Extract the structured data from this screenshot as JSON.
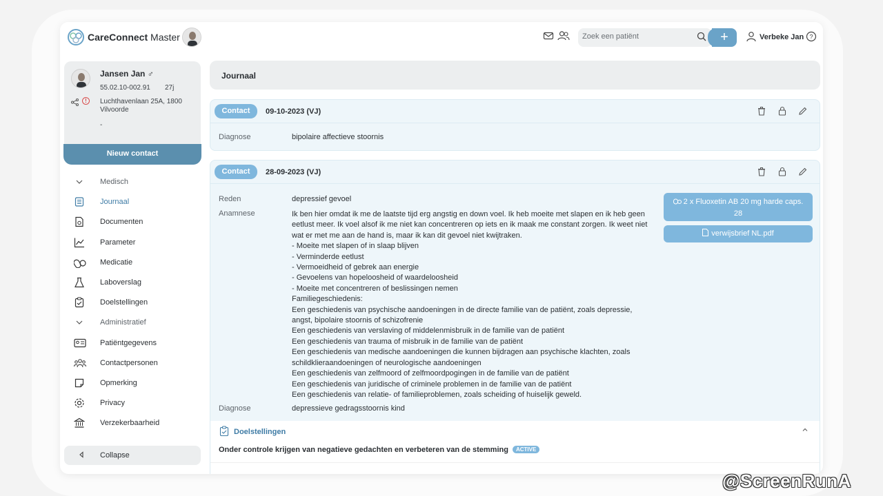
{
  "app": {
    "title_bold": "CareConnect",
    "title_light": "Master",
    "colors": {
      "accent": "#7fb7dd",
      "accent_dark": "#5b8fae",
      "link": "#3e7ba5"
    }
  },
  "topbar": {
    "search_placeholder": "Zoek een patiënt",
    "add_label": "+",
    "user_name": "Verbeke Jan",
    "icons": [
      "mail-icon",
      "people-icon",
      "search-icon",
      "user-icon",
      "help-icon"
    ]
  },
  "patient": {
    "name": "Jansen Jan ♂",
    "id": "55.02.10-002.91",
    "age": "27j",
    "alert_symbol": "!",
    "address": "Luchthavenlaan 25A, 1800 Vilvoorde",
    "extra": "-",
    "new_contact_label": "Nieuw contact"
  },
  "sidebar": {
    "items": [
      {
        "label": "Medisch",
        "icon": "chevron-down-icon",
        "group": true
      },
      {
        "label": "Journaal",
        "icon": "journal-icon",
        "active": true
      },
      {
        "label": "Documenten",
        "icon": "document-icon"
      },
      {
        "label": "Parameter",
        "icon": "chart-icon"
      },
      {
        "label": "Medicatie",
        "icon": "pills-icon"
      },
      {
        "label": "Laboverslag",
        "icon": "flask-icon"
      },
      {
        "label": "Doelstellingen",
        "icon": "clipboard-icon"
      },
      {
        "label": "Administratief",
        "icon": "chevron-down-icon",
        "group": true
      },
      {
        "label": "Patiëntgegevens",
        "icon": "id-card-icon"
      },
      {
        "label": "Contactpersonen",
        "icon": "contacts-icon"
      },
      {
        "label": "Opmerking",
        "icon": "note-icon"
      },
      {
        "label": "Privacy",
        "icon": "gear-icon"
      },
      {
        "label": "Verzekerbaarheid",
        "icon": "bank-icon"
      }
    ],
    "collapse_label": "Collapse"
  },
  "main": {
    "header": "Journaal",
    "entries": [
      {
        "tag": "Contact",
        "date": "09-10-2023 (VJ)",
        "diagnose_label": "Diagnose",
        "diagnose": "bipolaire affectieve stoornis"
      },
      {
        "tag": "Contact",
        "date": "28-09-2023 (VJ)",
        "reden_label": "Reden",
        "reden": "depressief gevoel",
        "anamnese_label": "Anamnese",
        "anamnese": "Ik ben hier omdat ik me de laatste tijd erg angstig en down voel. Ik heb moeite met slapen en ik heb geen eetlust meer. Ik voel alsof ik me niet kan concentreren op iets en ik maak me constant zorgen. Ik weet niet wat er met me aan de hand is, maar ik kan dit gevoel niet kwijtraken.\n- Moeite met slapen of in slaap blijven\n- Verminderde eetlust\n- Vermoeidheid of gebrek aan energie\n- Gevoelens van hopeloosheid of waardeloosheid\n- Moeite met concentreren of beslissingen nemen\nFamiliegeschiedenis:\nEen geschiedenis van psychische aandoeningen in de directe familie van de patiënt, zoals depressie, angst, bipolaire stoornis of schizofrenie\nEen geschiedenis van verslaving of middelenmisbruik in de familie van de patiënt\nEen geschiedenis van trauma of misbruik in de familie van de patiënt\nEen geschiedenis van medische aandoeningen die kunnen bijdragen aan psychische klachten, zoals schildklieraandoeningen of neurologische aandoeningen\nEen geschiedenis van zelfmoord of zelfmoordpogingen in de familie van de patiënt\nEen geschiedenis van juridische of criminele problemen in de familie van de patiënt\nEen geschiedenis van relatie- of familieproblemen, zoals scheiding of huiselijk geweld.",
        "diagnose_label": "Diagnose",
        "diagnose": "depressieve gedragsstoornis kind",
        "medication_button": "2 x Fluoxetin AB 20 mg harde caps. 28",
        "document_button": "verwijsbrief NL.pdf",
        "goals_title": "Doelstellingen",
        "goal": "Onder controle krijgen van negatieve gedachten en verbeteren van de stemming",
        "goal_status": "ACTIVE"
      }
    ]
  },
  "watermark": "@ScreenRunA"
}
